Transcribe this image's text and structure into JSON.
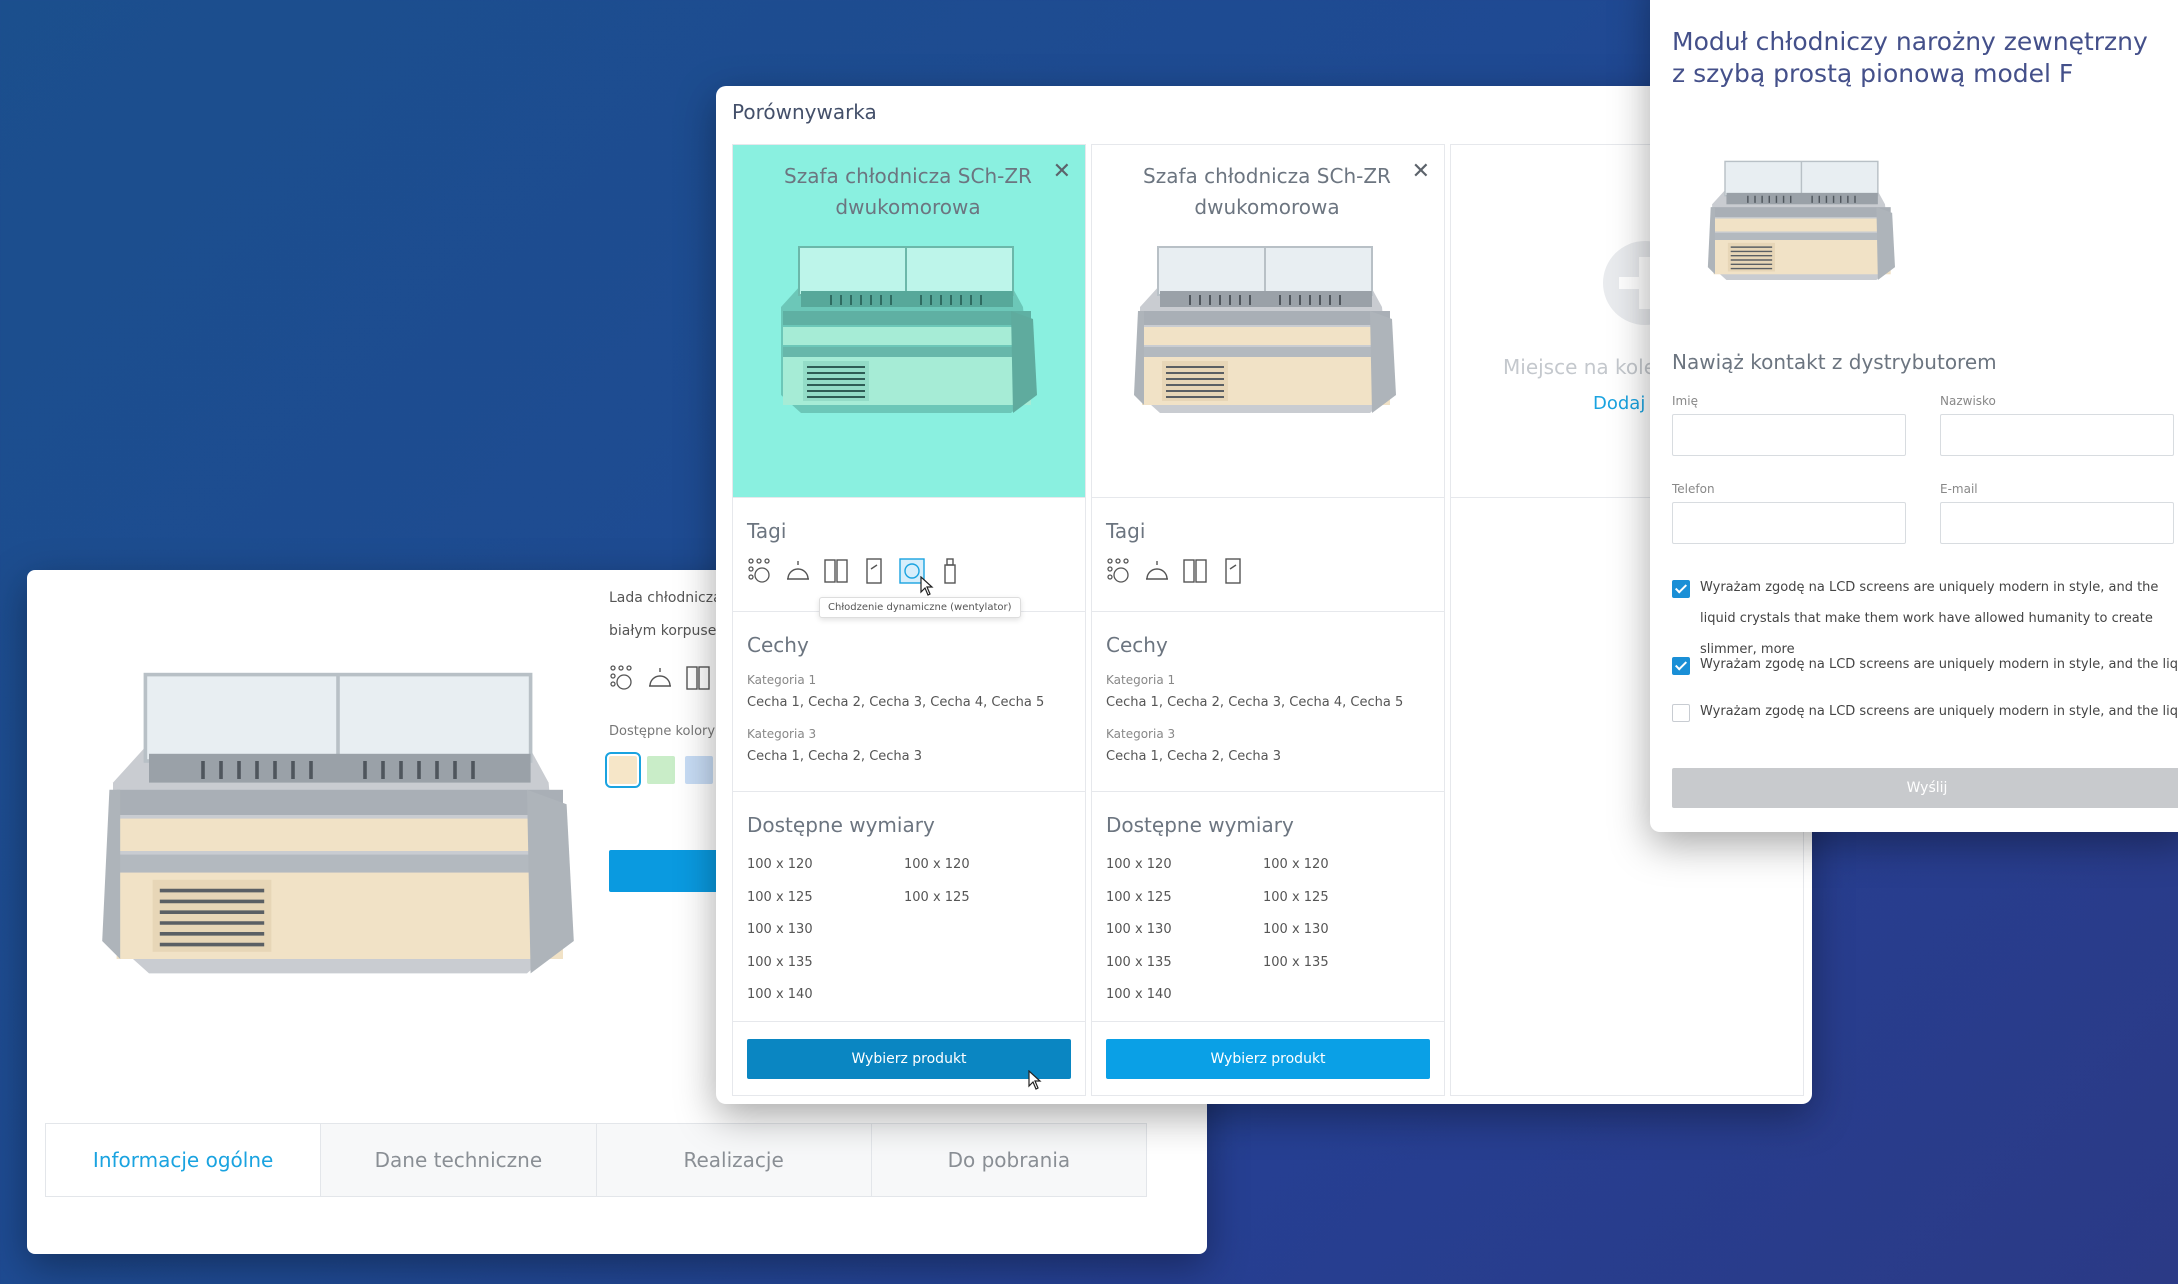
{
  "product_card": {
    "description": [
      "Lada chłodnicza z",
      "białym korpusem"
    ],
    "colors_label": "Dostępne kolory",
    "swatches": [
      "#f6e6c8",
      "#c9edc8",
      "#c7dcf5",
      "#f3c9d9"
    ],
    "tabs": [
      {
        "label": "Informacje ogólne",
        "active": true
      },
      {
        "label": "Dane techniczne",
        "active": false
      },
      {
        "label": "Realizacje",
        "active": false
      },
      {
        "label": "Do pobrania",
        "active": false
      }
    ]
  },
  "comparator": {
    "title": "Porównywarka",
    "columns": [
      {
        "name": "Szafa chłodnicza SCh-ZR dwukomorowa",
        "close": "✕",
        "tags_title": "Tagi",
        "tooltip": "Chłodzenie dynamiczne (wentylator)",
        "features_title": "Cechy",
        "features": [
          {
            "category": "Kategoria 1",
            "values": "Cecha 1, Cecha 2, Cecha 3, Cecha 4, Cecha 5"
          },
          {
            "category": "Kategoria 3",
            "values": "Cecha 1, Cecha 2, Cecha 3"
          }
        ],
        "dims_title": "Dostępne wymiary",
        "dims_left": [
          "100 x 120",
          "100 x 125",
          "100 x 130",
          "100 x 135",
          "100 x 140"
        ],
        "dims_right": [
          "100 x 120",
          "100 x 125"
        ],
        "button": "Wybierz produkt"
      },
      {
        "name": "Szafa chłodnicza SCh-ZR dwukomorowa",
        "close": "✕",
        "tags_title": "Tagi",
        "features_title": "Cechy",
        "features": [
          {
            "category": "Kategoria 1",
            "values": "Cecha 1, Cecha 2, Cecha 3, Cecha 4, Cecha 5"
          },
          {
            "category": "Kategoria 3",
            "values": "Cecha 1, Cecha 2, Cecha 3"
          }
        ],
        "dims_title": "Dostępne wymiary",
        "dims_left": [
          "100 x 120",
          "100 x 125",
          "100 x 130",
          "100 x 135",
          "100 x 140"
        ],
        "dims_right": [
          "100 x 120",
          "100 x 125",
          "100 x 130",
          "100 x 135"
        ],
        "button": "Wybierz produkt"
      }
    ],
    "empty_slot": {
      "text": "Miejsce na kolej",
      "link": "Dodaj"
    }
  },
  "contact": {
    "product_title": "Moduł chłodniczy narożny zewnętrzny z szybą prostą pionową model F",
    "form_title": "Nawiąż kontakt z dystrybutorem",
    "labels": {
      "first_name": "Imię",
      "last_name": "Nazwisko",
      "phone": "Telefon",
      "email": "E-mail"
    },
    "consents": [
      {
        "checked": true,
        "text": "Wyrażam zgodę na LCD screens are uniquely modern in style, and the liquid crystals that make them work have allowed humanity to create slimmer, more"
      },
      {
        "checked": true,
        "text": "Wyrażam zgodę na LCD screens are uniquely modern in style, and the liquid"
      },
      {
        "checked": false,
        "text": "Wyrażam zgodę na LCD screens are uniquely modern in style, and the liquid"
      }
    ],
    "send": "Wyślij"
  }
}
